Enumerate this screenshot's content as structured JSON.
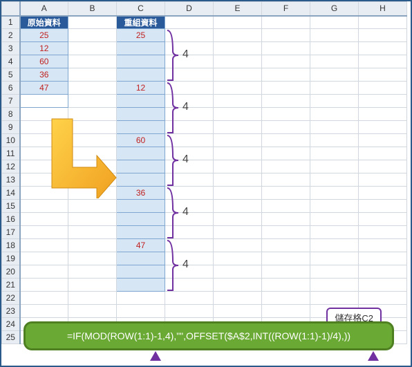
{
  "columns": [
    "A",
    "B",
    "C",
    "D",
    "E",
    "F",
    "G",
    "H"
  ],
  "rows": [
    "1",
    "2",
    "3",
    "4",
    "5",
    "6",
    "7",
    "8",
    "9",
    "10",
    "11",
    "12",
    "13",
    "14",
    "15",
    "16",
    "17",
    "18",
    "19",
    "20",
    "21",
    "22",
    "23",
    "24",
    "25"
  ],
  "headerA": "原始資料",
  "headerC": "重組資料",
  "colA_values": {
    "2": "25",
    "3": "12",
    "4": "60",
    "5": "36",
    "6": "47"
  },
  "colC_values": {
    "2": "25",
    "6": "12",
    "10": "60",
    "14": "36",
    "18": "47"
  },
  "bracket_label": "4",
  "formula": "=IF(MOD(ROW(1:1)-1,4),\"\",OFFSET($A$2,INT((ROW(1:1)-1)/4),))",
  "callout": "儲存格C2"
}
